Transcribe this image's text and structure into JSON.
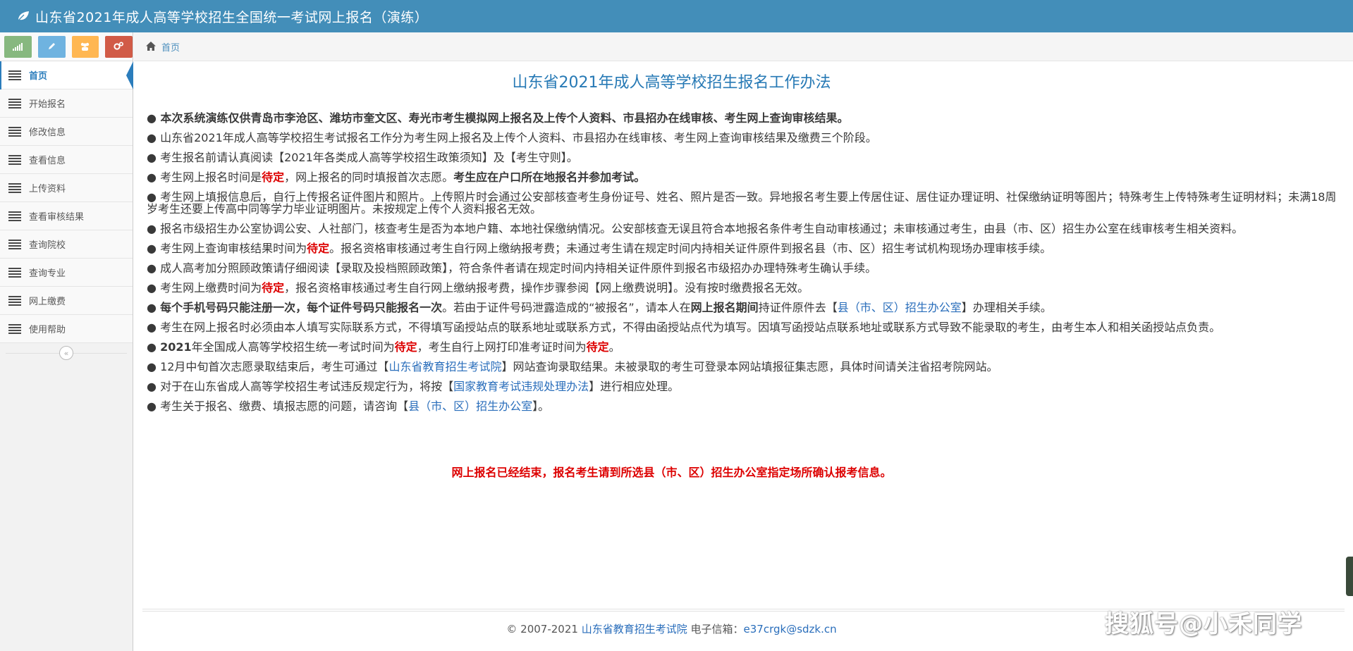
{
  "app": {
    "title": "山东省2021年成人高等学校招生全国统一考试网上报名（演练）"
  },
  "sidebar": {
    "shortcuts": [
      {
        "icon": "signal-icon",
        "color": "#87b87f"
      },
      {
        "icon": "pencil-icon",
        "color": "#6fb3e0"
      },
      {
        "icon": "group-icon",
        "color": "#ffb752"
      },
      {
        "icon": "cogs-icon",
        "color": "#d15b47"
      }
    ],
    "items": [
      {
        "label": "首页",
        "active": true
      },
      {
        "label": "开始报名"
      },
      {
        "label": "修改信息"
      },
      {
        "label": "查看信息"
      },
      {
        "label": "上传资料"
      },
      {
        "label": "查看审核结果"
      },
      {
        "label": "查询院校"
      },
      {
        "label": "查询专业"
      },
      {
        "label": "网上缴费"
      },
      {
        "label": "使用帮助"
      }
    ],
    "collapse_glyph": "«"
  },
  "breadcrumb": {
    "home": "首页"
  },
  "main": {
    "title": "山东省2021年成人高等学校招生报名工作办法",
    "bullet": "●",
    "notices": {
      "n1": "本次系统演练仅供青岛市李沧区、潍坊市奎文区、寿光市考生模拟网上报名及上传个人资料、市县招办在线审核、考生网上查询审核结果。",
      "n2": "山东省2021年成人高等学校招生考试报名工作分为考生网上报名及上传个人资料、市县招办在线审核、考生网上查询审核结果及缴费三个阶段。",
      "n3": "考生报名前请认真阅读【2021年各类成人高等学校招生政策须知】及【考生守则】。",
      "n4a": "考生网上报名时间是",
      "n4b": "待定",
      "n4c": "，网上报名的同时填报首次志愿。",
      "n4d": "考生应在户口所在地报名并参加考试。",
      "n5": "考生网上填报信息后，自行上传报名证件图片和照片。上传照片时会通过公安部核查考生身份证号、姓名、照片是否一致。异地报名考生要上传居住证、居住证办理证明、社保缴纳证明等图片；特殊考生上传特殊考生证明材料；未满18周岁考生还要上传高中同等学力毕业证明图片。未按规定上传个人资料报名无效。",
      "n6": "报名市级招生办公室协调公安、人社部门，核查考生是否为本地户籍、本地社保缴纳情况。公安部核查无误且符合本地报名条件考生自动审核通过；未审核通过考生，由县（市、区）招生办公室在线审核考生相关资料。",
      "n7a": "考生网上查询审核结果时间为",
      "n7b": "待定",
      "n7c": "。报名资格审核通过考生自行网上缴纳报考费；未通过考生请在规定时间内持相关证件原件到报名县（市、区）招生考试机构现场办理审核手续。",
      "n8": "成人高考加分照顾政策请仔细阅读【录取及投档照顾政策】，符合条件者请在规定时间内持相关证件原件到报名市级招办办理特殊考生确认手续。",
      "n9a": "考生网上缴费时间为",
      "n9b": "待定",
      "n9c": "，报名资格审核通过考生自行网上缴纳报考费，操作步骤参阅【网上缴费说明】。没有按时缴费报名无效。",
      "n10a": "每个手机号码只能注册一次，每个证件号码只能报名一次",
      "n10b": "。若由于证件号码泄露造成的“被报名”，请本人在",
      "n10c": "网上报名期间",
      "n10d": "持证件原件去【",
      "n10e": "县（市、区）招生办公室",
      "n10f": "】办理相关手续。",
      "n11": "考生在网上报名时必须由本人填写实际联系方式，不得填写函授站点的联系地址或联系方式，不得由函授站点代为填写。因填写函授站点联系地址或联系方式导致不能录取的考生，由考生本人和相关函授站点负责。",
      "n12a": "2021",
      "n12b": "年全国成人高等学校招生统一考试时间为",
      "n12c": "待定",
      "n12d": "，考生自行上网打印准考证时间为",
      "n12e": "待定",
      "n12f": "。",
      "n13a": "12月中旬首次志愿录取结束后，考生可通过【",
      "n13b": "山东省教育招生考试院",
      "n13c": "】网站查询录取结果。未被录取的考生可登录本网站填报征集志愿，具体时间请关注省招考院网站。",
      "n14a": "对于在山东省成人高等学校招生考试违反规定行为，将按【",
      "n14b": "国家教育考试违规处理办法",
      "n14c": "】进行相应处理。",
      "n15a": "考生关于报名、缴费、填报志愿的问题，请咨询【",
      "n15b": "县（市、区）招生办公室",
      "n15c": "】。"
    },
    "closing": "网上报名已经结束，报名考生请到所选县（市、区）招生办公室指定场所确认报考信息。"
  },
  "footer": {
    "copyright": "© 2007-2021",
    "org": "山东省教育招生考试院",
    "email_label": "电子信箱：",
    "email": "e37crgk@sdzk.cn"
  },
  "watermark": "搜狐号@小禾同学",
  "colors": {
    "header_bg": "#438eb9",
    "accent": "#2679b5",
    "alert": "#dd0000"
  }
}
